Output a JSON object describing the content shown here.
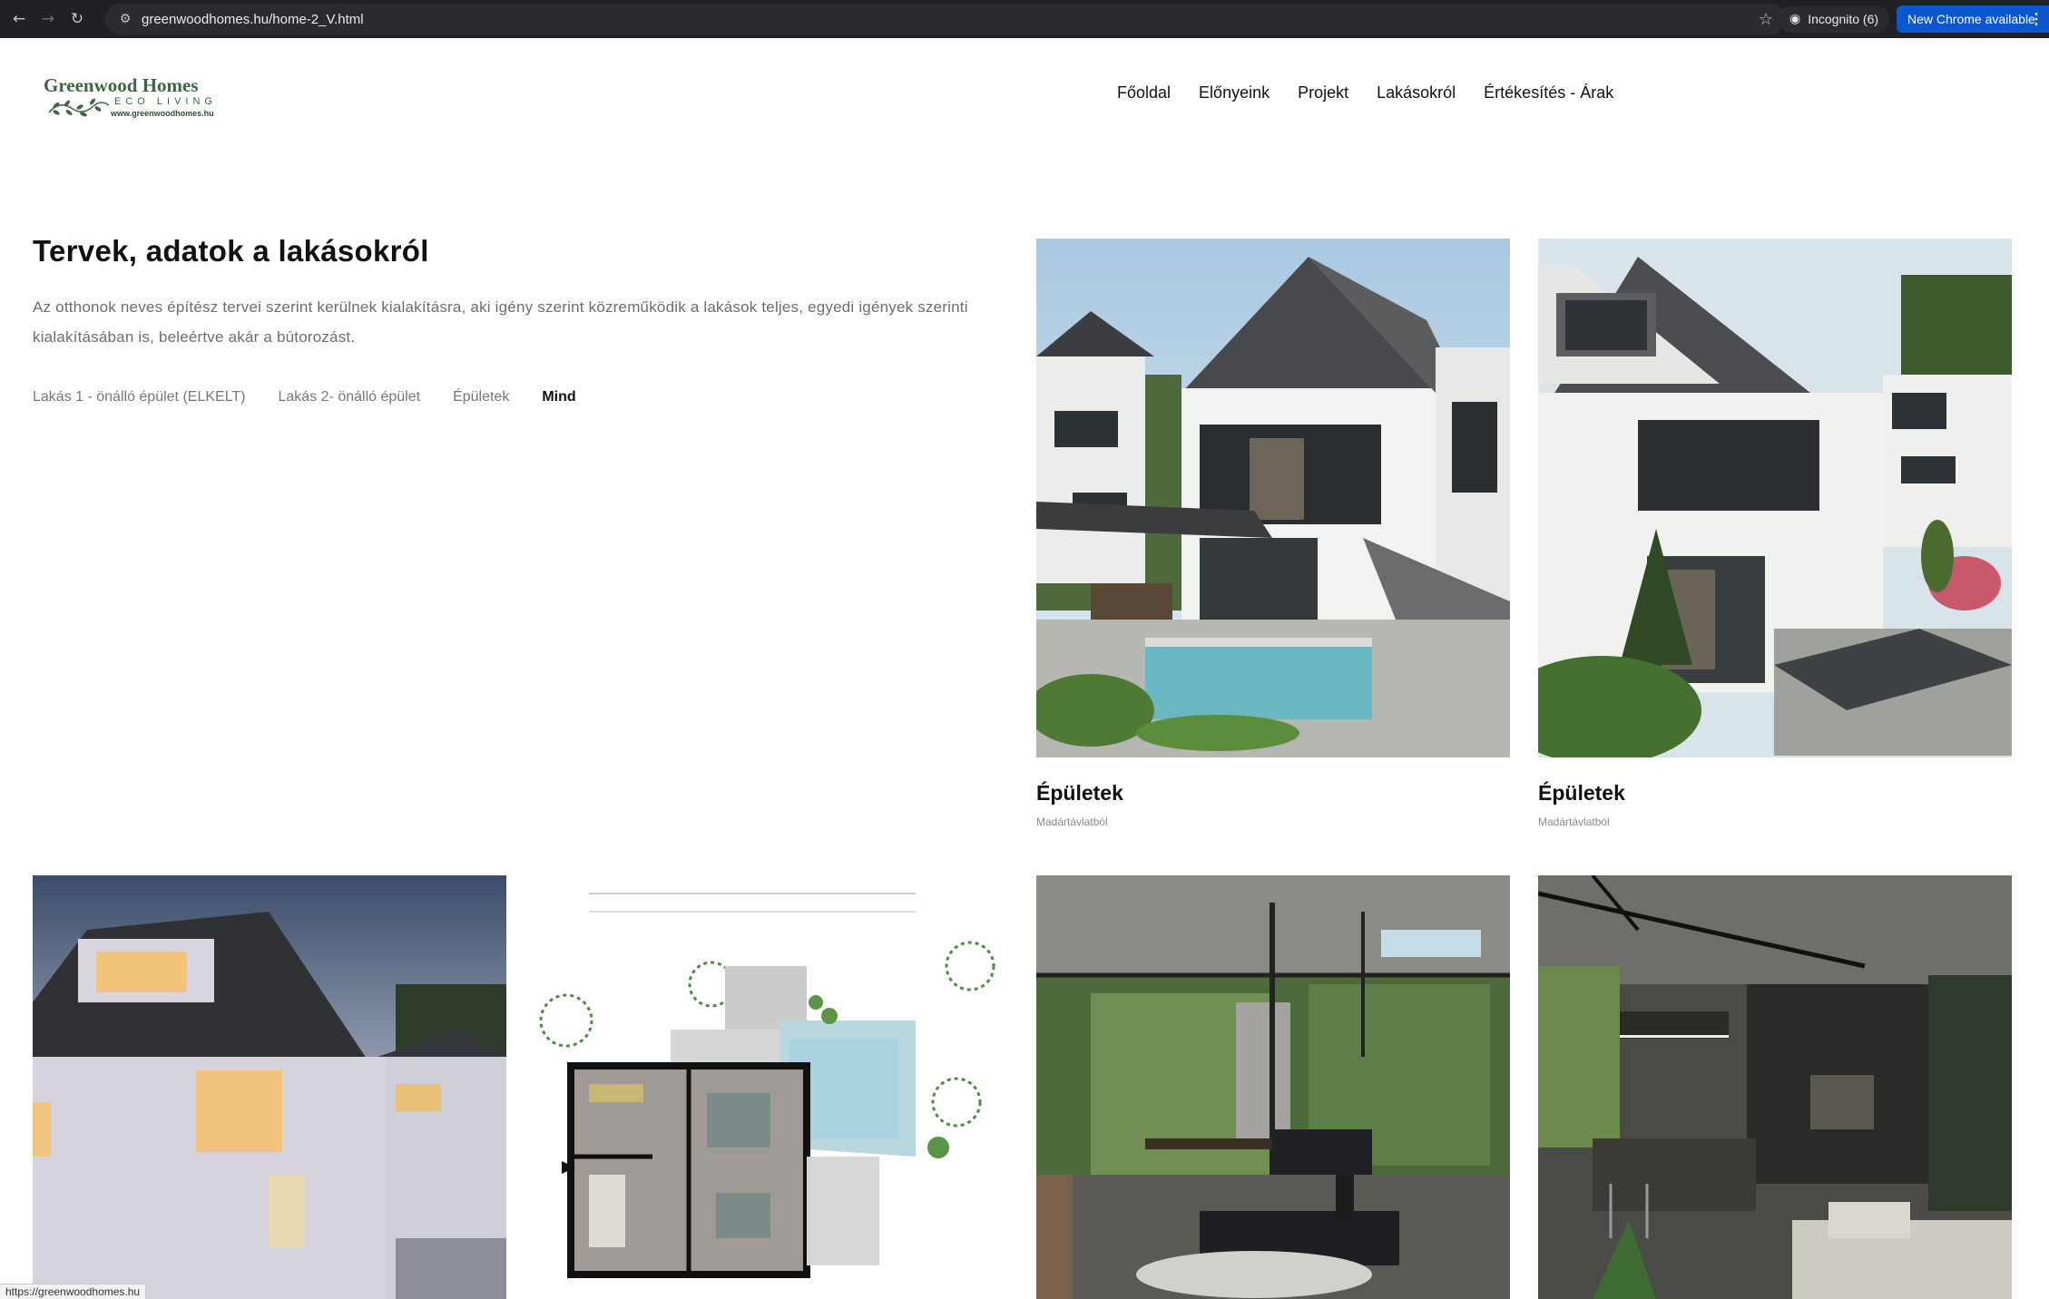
{
  "browser": {
    "url": "greenwoodhomes.hu/home-2_V.html",
    "incognito_label": "Incognito (6)",
    "update_label": "New Chrome available",
    "status_url": "https://greenwoodhomes.hu"
  },
  "site": {
    "logo": {
      "title": "Greenwood Homes",
      "subtitle": "ECO LIVING",
      "url": "www.greenwoodhomes.hu"
    },
    "nav": [
      "Főoldal",
      "Előnyeink",
      "Projekt",
      "Lakásokról",
      "Értékesítés - Árak"
    ]
  },
  "main": {
    "title": "Tervek, adatok a lakásokról",
    "intro": "Az otthonok neves építész tervei szerint kerülnek kialakításra, aki igény szerint közreműködik a lakások teljes, egyedi igények szerinti kialakításában is, beleértve akár a bútorozást.",
    "filters": [
      {
        "label": "Lakás 1 - önálló épület (ELKELT)",
        "active": false
      },
      {
        "label": "Lakás 2- önálló épület",
        "active": false
      },
      {
        "label": "Épületek",
        "active": false
      },
      {
        "label": "Mind",
        "active": true
      }
    ],
    "cards": [
      {
        "title": "Épületek",
        "subtitle": "Madártávlatból"
      },
      {
        "title": "Épületek",
        "subtitle": "Madártávlatból"
      }
    ]
  },
  "colors": {
    "brand_green": "#3e6546",
    "chrome_bg": "#202124",
    "update_blue": "#0b57d0"
  }
}
